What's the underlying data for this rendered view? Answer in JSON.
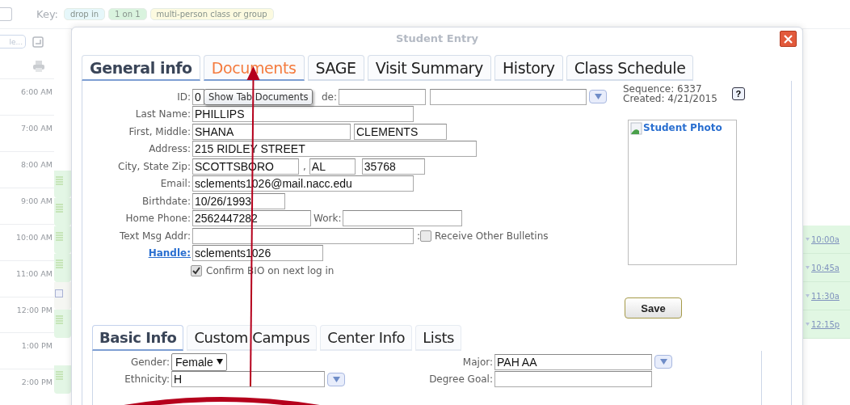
{
  "top_checkbox": {
    "checked": false
  },
  "key_legend": {
    "label": "Key:",
    "items": [
      {
        "label": "drop in",
        "color": "#e6f7fa"
      },
      {
        "label": "1 on 1",
        "color": "#d9f3de"
      },
      {
        "label": "multi-person class or group",
        "color": "#fcfae0"
      }
    ]
  },
  "toolbar": {
    "button": "le..."
  },
  "calendar": {
    "times": [
      "6:00 AM",
      "7:00 AM",
      "8:00 AM",
      "9:00 AM",
      "10:00 AM",
      "11:00 AM",
      "12:00 PM",
      "1:00 PM",
      "2:00 PM"
    ],
    "left_events": [
      {
        "kind": "empty"
      },
      {
        "kind": "group"
      },
      {
        "kind": "group"
      },
      {
        "kind": "group"
      },
      {
        "kind": "group"
      },
      {
        "kind": "individual"
      },
      {
        "kind": "group"
      },
      {
        "kind": "empty"
      },
      {
        "kind": "group"
      }
    ],
    "right_events": [
      {
        "time": "10:00a"
      },
      {
        "time": "10:45a"
      },
      {
        "time": "11:30a"
      },
      {
        "time": "12:15p"
      }
    ]
  },
  "dialog": {
    "title": "Student Entry",
    "tabs": [
      {
        "label": "General info",
        "selected": true,
        "hovered": false
      },
      {
        "label": "Documents",
        "selected": false,
        "hovered": true
      },
      {
        "label": "SAGE",
        "selected": false,
        "hovered": false
      },
      {
        "label": "Visit Summary",
        "selected": false,
        "hovered": false
      },
      {
        "label": "History",
        "selected": false,
        "hovered": false
      },
      {
        "label": "Class Schedule",
        "selected": false,
        "hovered": false
      }
    ],
    "tooltip": "Show Tab Documents",
    "form": [
      {
        "label": "ID:",
        "items": [
          {
            "kind": "field",
            "value": "0"
          },
          {
            "kind": "text",
            "text": "de:"
          },
          {
            "kind": "field"
          },
          {
            "kind": "field"
          },
          {
            "kind": "dropdown"
          }
        ]
      },
      {
        "label": "Last Name:",
        "items": [
          {
            "kind": "field",
            "value": "PHILLIPS"
          }
        ]
      },
      {
        "label": "First, Middle:",
        "items": [
          {
            "kind": "field",
            "value": "SHANA"
          },
          {
            "kind": "field",
            "value": "CLEMENTS"
          }
        ]
      },
      {
        "label": "Address:",
        "items": [
          {
            "kind": "field",
            "value": "215 RIDLEY STREET"
          }
        ]
      },
      {
        "label": "City, State Zip:",
        "items": [
          {
            "kind": "field",
            "value": "SCOTTSBORO"
          },
          {
            "kind": "text",
            "text": ","
          },
          {
            "kind": "field",
            "value": "AL"
          },
          {
            "kind": "field",
            "value": "35768"
          }
        ]
      },
      {
        "label": "Email:",
        "items": [
          {
            "kind": "field",
            "value": "sclements1026@mail.nacc.edu"
          }
        ]
      },
      {
        "label": "Birthdate:",
        "items": [
          {
            "kind": "field",
            "value": "10/26/1993"
          }
        ]
      },
      {
        "label": "Home Phone:",
        "items": [
          {
            "kind": "field",
            "value": "2562447282"
          },
          {
            "kind": "text",
            "text": "Work:"
          },
          {
            "kind": "field"
          }
        ]
      },
      {
        "label": "Text Msg Addr:",
        "items": [
          {
            "kind": "field"
          },
          {
            "kind": "text",
            "text": ":"
          },
          {
            "kind": "checkbox",
            "checked": false
          },
          {
            "kind": "text",
            "text": "Receive Other Bulletins"
          }
        ]
      },
      {
        "label": "Handle:",
        "link": true,
        "items": [
          {
            "kind": "field",
            "value": "sclements1026"
          }
        ]
      },
      {
        "items": [
          {
            "kind": "checkbox",
            "checked": true
          },
          {
            "kind": "text",
            "text": "Confirm BIO on next log in"
          }
        ]
      }
    ],
    "record": {
      "sequence": "Sequence: 6337",
      "created": "Created: 4/21/2015"
    },
    "help": "?",
    "photo": "Student Photo",
    "save": "Save",
    "subtabs": [
      {
        "label": "Basic Info",
        "selected": true
      },
      {
        "label": "Custom Campus",
        "selected": false
      },
      {
        "label": "Center Info",
        "selected": false
      },
      {
        "label": "Lists",
        "selected": false
      }
    ],
    "basic_info": {
      "left": [
        {
          "label": "Gender:",
          "items": [
            {
              "kind": "select",
              "value": "Female"
            }
          ]
        },
        {
          "label": "Ethnicity:",
          "items": [
            {
              "kind": "field",
              "value": "H"
            },
            {
              "kind": "dropdown"
            }
          ]
        }
      ],
      "right": [
        {
          "label": "Major:",
          "items": [
            {
              "kind": "field",
              "value": "PAH AA"
            },
            {
              "kind": "dropdown"
            }
          ]
        },
        {
          "label": "Degree Goal:",
          "items": [
            {
              "kind": "field"
            }
          ]
        }
      ]
    }
  }
}
